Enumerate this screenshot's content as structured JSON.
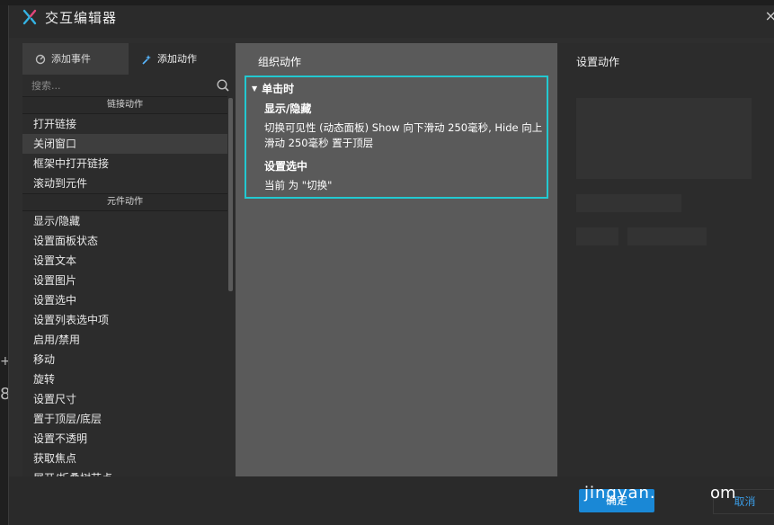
{
  "window": {
    "title": "交互编辑器",
    "close_label": "×"
  },
  "left_panel": {
    "tabs": [
      {
        "label": "添加事件",
        "icon": "event-icon"
      },
      {
        "label": "添加动作",
        "icon": "action-sparkle-icon"
      }
    ],
    "search_placeholder": "搜索...",
    "groups": [
      {
        "header": "链接动作",
        "items": [
          "打开链接",
          "关闭窗口",
          "框架中打开链接",
          "滚动到元件"
        ]
      },
      {
        "header": "元件动作",
        "items": [
          "显示/隐藏",
          "设置面板状态",
          "设置文本",
          "设置图片",
          "设置选中",
          "设置列表选中项",
          "启用/禁用",
          "移动",
          "旋转",
          "设置尺寸",
          "置于顶层/底层",
          "设置不透明",
          "获取焦点",
          "展开/折叠树节点"
        ]
      }
    ],
    "selected_item": "关闭窗口"
  },
  "middle_panel": {
    "title": "组织动作",
    "case": {
      "label": "单击时",
      "actions": [
        {
          "title": "显示/隐藏",
          "description": "切换可见性 (动态面板) Show 向下滑动 250毫秒, Hide 向上滑动 250毫秒 置于顶层"
        },
        {
          "title": "设置选中",
          "description": "当前 为 \"切换\""
        }
      ]
    },
    "highlight_color": "#22c9d1"
  },
  "right_panel": {
    "title": "设置动作"
  },
  "footer": {
    "ok_label": "确定",
    "cancel_label": "取消",
    "watermark": "jingyan.",
    "watermark_tail": "om"
  },
  "background": {
    "left_marks": [
      "+",
      "8"
    ]
  },
  "colors": {
    "accent": "#1a88d6",
    "case_border": "#22c9d1",
    "mid_bg": "#5a5a5a"
  }
}
